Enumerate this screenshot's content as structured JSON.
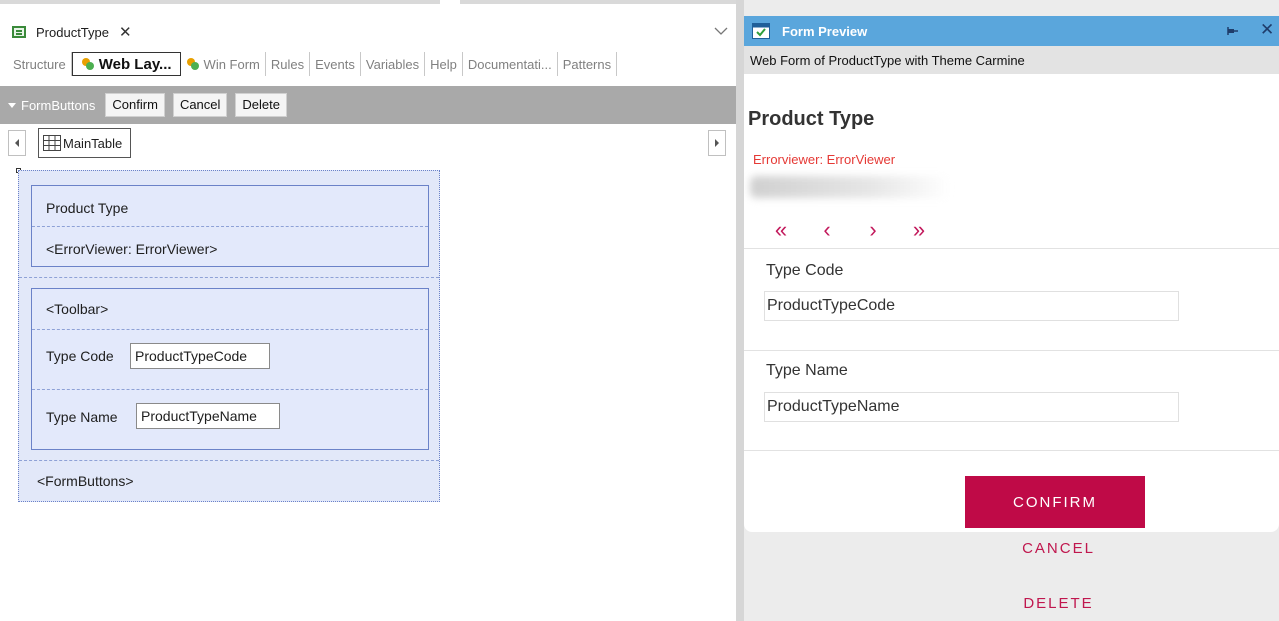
{
  "document_tab": {
    "title": "ProductType",
    "close": "✕"
  },
  "subtabs": [
    {
      "label": "Structure"
    },
    {
      "label": "Web Lay..."
    },
    {
      "label": "Win Form"
    },
    {
      "label": "Rules"
    },
    {
      "label": "Events"
    },
    {
      "label": "Variables"
    },
    {
      "label": "Help"
    },
    {
      "label": "Documentati..."
    },
    {
      "label": "Patterns"
    }
  ],
  "toolbar": {
    "group_label": "FormButtons",
    "buttons": [
      "Confirm",
      "Cancel",
      "Delete"
    ]
  },
  "nav": {
    "main_table_label": "MainTable"
  },
  "canvas": {
    "title_text": "Product Type",
    "error_viewer": "<ErrorViewer: ErrorViewer>",
    "toolbar_placeholder": "<Toolbar>",
    "type_code_label": "Type Code",
    "type_code_field": "ProductTypeCode",
    "type_name_label": "Type Name",
    "type_name_field": "ProductTypeName",
    "form_buttons": "<FormButtons>"
  },
  "preview": {
    "window_title": "Form Preview",
    "subtitle": "Web Form of ProductType with Theme Carmine",
    "form_title": "Product Type",
    "error_viewer": "Errorviewer: ErrorViewer",
    "nav": {
      "first": "«",
      "prev": "‹",
      "next": "›",
      "last": "»"
    },
    "type_code_label": "Type Code",
    "type_code_value": "ProductTypeCode",
    "type_name_label": "Type Name",
    "type_name_value": "ProductTypeName",
    "confirm": "CONFIRM",
    "cancel": "CANCEL",
    "delete": "DELETE"
  },
  "colors": {
    "preview_header": "#5aa6dc",
    "accent": "#bf0a47",
    "error_text": "#e53935",
    "canvas_fill": "#e2e8f9",
    "toolbar_bg": "#a9a9a9"
  },
  "icons": {
    "tab": "form-icon",
    "web_layout": "web-layout-icon",
    "win_form": "win-form-icon",
    "grid": "grid-icon",
    "preview": "preview-icon",
    "pin": "pin-icon"
  }
}
